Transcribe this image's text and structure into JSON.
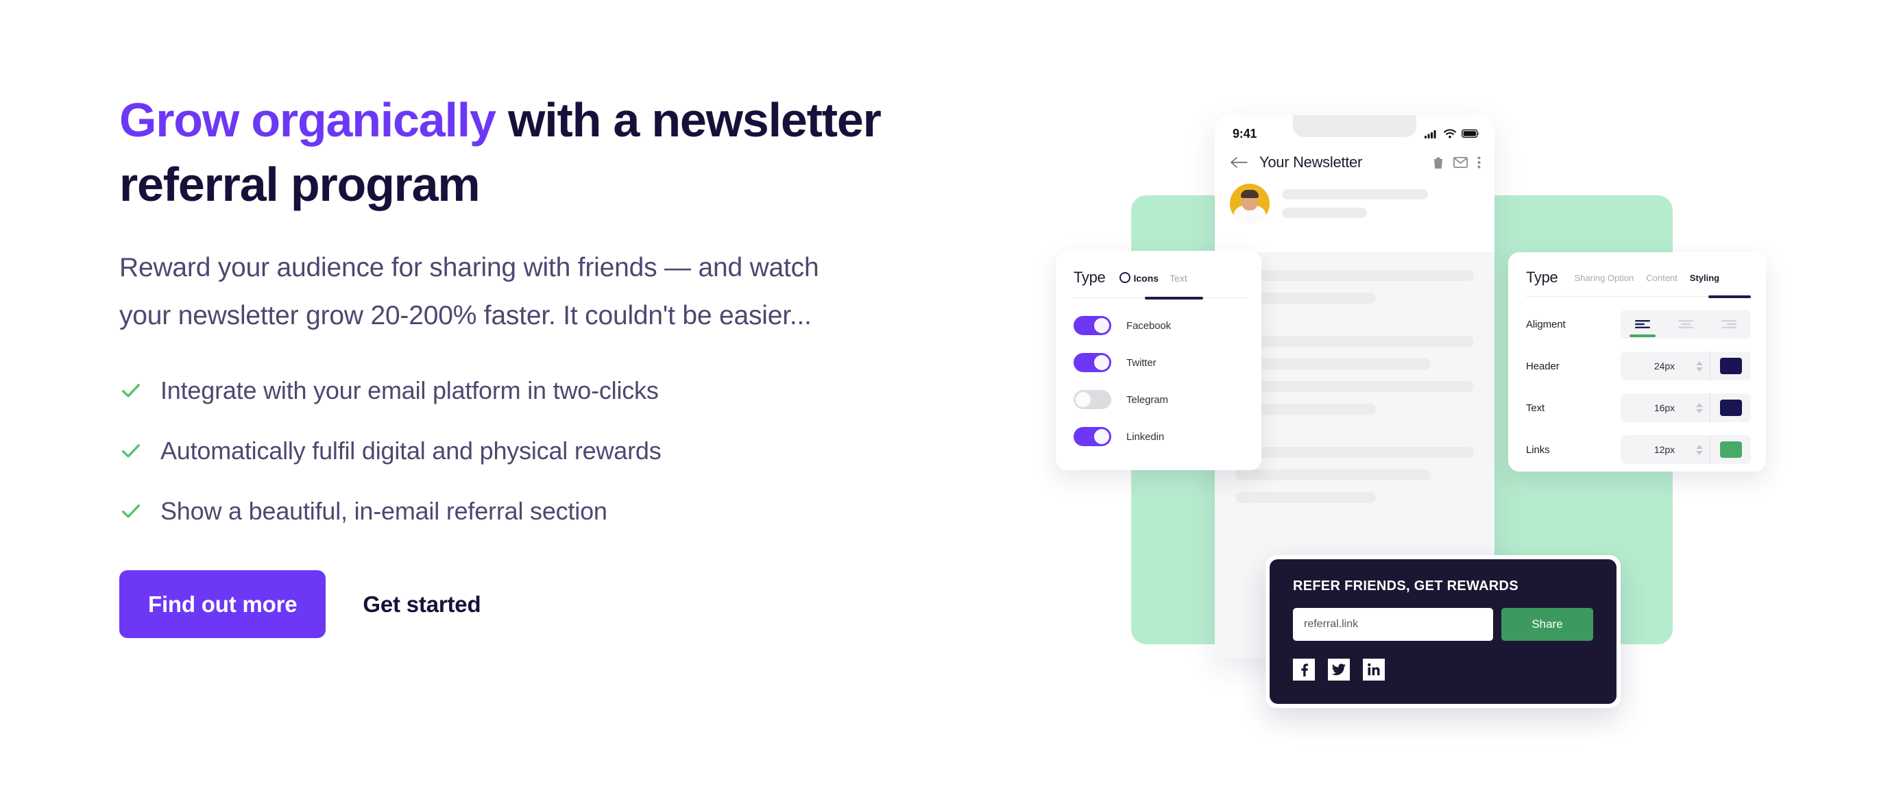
{
  "hero": {
    "headline_accent": "Grow organically",
    "headline_rest": " with a newsletter referral program",
    "subcopy": "Reward your audience for sharing with friends — and watch your newsletter grow 20-200% faster. It couldn't be easier...",
    "bullets": [
      "Integrate with your email platform in two-clicks",
      "Automatically fulfil digital and physical rewards",
      "Show a beautiful, in-email referral section"
    ],
    "primary_cta": "Find out more",
    "secondary_cta": "Get started",
    "colors": {
      "accent_purple": "#6c38f5",
      "heading_dark": "#16113a",
      "body_text": "#4d4870",
      "check_green": "#58c16f"
    }
  },
  "illustration": {
    "green_backdrop_color": "#b6ecce",
    "phone": {
      "status_time": "9:41",
      "signal_icon": "cellular-signal-icon",
      "wifi_icon": "wifi-icon",
      "battery_icon": "battery-icon",
      "back_icon": "back-arrow-icon",
      "mail_title": "Your Newsletter",
      "action_icons": [
        "trash-icon",
        "envelope-icon",
        "overflow-menu-icon"
      ],
      "avatar_alt": "sender-avatar"
    },
    "icons_panel": {
      "title": "Type",
      "tabs": [
        {
          "label": "Icons",
          "active": true
        },
        {
          "label": "Text",
          "active": false
        }
      ],
      "toggles": [
        {
          "label": "Facebook",
          "on": true
        },
        {
          "label": "Twitter",
          "on": true
        },
        {
          "label": "Telegram",
          "on": false
        },
        {
          "label": "Linkedin",
          "on": true
        }
      ],
      "toggle_on_color": "#6c38f5",
      "toggle_off_color": "#dcdce1"
    },
    "styling_panel": {
      "title": "Type",
      "tabs": [
        {
          "label": "Sharing Option",
          "active": false
        },
        {
          "label": "Content",
          "active": false
        },
        {
          "label": "Styling",
          "active": true
        }
      ],
      "rows": [
        {
          "label": "Aligment",
          "type": "alignment",
          "selected": "left"
        },
        {
          "label": "Header",
          "type": "stepper",
          "value": "24px",
          "swatch": "#191552"
        },
        {
          "label": "Text",
          "type": "stepper",
          "value": "16px",
          "swatch": "#191552"
        },
        {
          "label": "Links",
          "type": "stepper",
          "value": "12px",
          "swatch": "#46ab68"
        }
      ],
      "active_underline_color": "#1b1b4d",
      "alignment_marker_color": "#46ab68"
    },
    "referral_card": {
      "title": "REFER FRIENDS, GET REWARDS",
      "input_value": "referral.link",
      "share_label": "Share",
      "socials": [
        "facebook-icon",
        "twitter-icon",
        "linkedin-icon"
      ],
      "background": "#1b1733",
      "share_color": "#3c9960"
    }
  }
}
